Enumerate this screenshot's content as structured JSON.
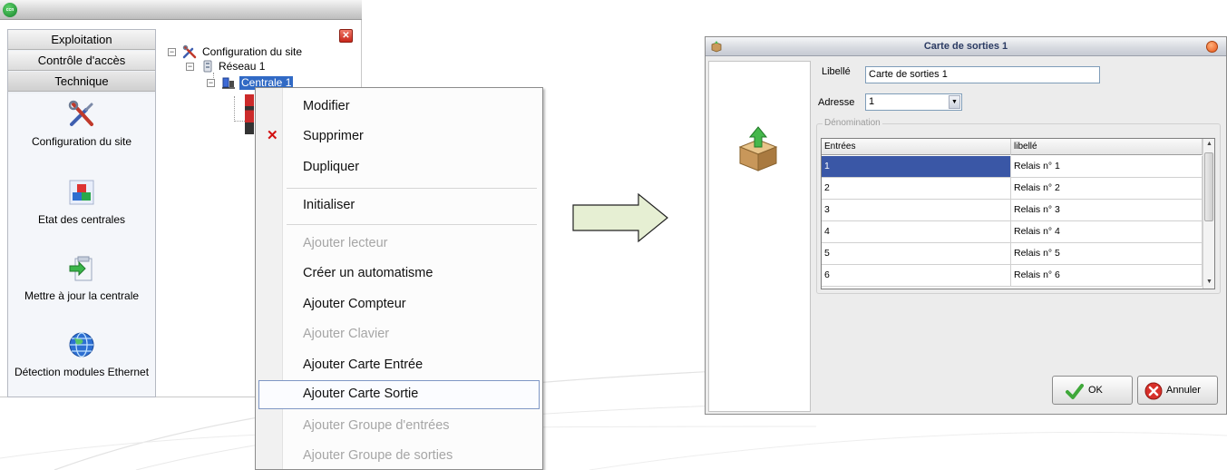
{
  "nav": {
    "tabs": [
      "Exploitation",
      "Contrôle d'accès",
      "Technique"
    ],
    "items": [
      {
        "label": "Configuration du site",
        "icon": "tools-icon"
      },
      {
        "label": "Etat des centrales",
        "icon": "status-blocks-icon"
      },
      {
        "label": "Mettre à jour la centrale",
        "icon": "update-arrow-icon"
      },
      {
        "label": "Détection modules Ethernet",
        "icon": "globe-network-icon"
      }
    ]
  },
  "tree": {
    "root": "Configuration du site",
    "network": "Réseau 1",
    "central": "Centrale 1"
  },
  "context_menu": {
    "items": [
      {
        "label": "Modifier",
        "enabled": true
      },
      {
        "label": "Supprimer",
        "enabled": true,
        "icon": "delete-x-icon"
      },
      {
        "label": "Dupliquer",
        "enabled": true
      },
      {
        "label": "Initialiser",
        "enabled": true
      },
      {
        "label": "Ajouter lecteur",
        "enabled": false
      },
      {
        "label": "Créer un automatisme",
        "enabled": true
      },
      {
        "label": "Ajouter Compteur",
        "enabled": true
      },
      {
        "label": "Ajouter Clavier",
        "enabled": false
      },
      {
        "label": "Ajouter Carte Entrée",
        "enabled": true
      },
      {
        "label": "Ajouter Carte Sortie",
        "enabled": true,
        "highlighted": true
      },
      {
        "label": "Ajouter Groupe d'entrées",
        "enabled": false
      },
      {
        "label": "Ajouter Groupe de sorties",
        "enabled": false
      }
    ]
  },
  "dialog": {
    "title": "Carte de sorties 1",
    "libelle_label": "Libellé",
    "libelle_value": "Carte de sorties 1",
    "adresse_label": "Adresse",
    "adresse_value": "1",
    "group_label": "Dénomination",
    "table": {
      "columns": [
        "Entrées",
        "libellé"
      ],
      "rows": [
        [
          "1",
          "Relais n° 1"
        ],
        [
          "2",
          "Relais n° 2"
        ],
        [
          "3",
          "Relais n° 3"
        ],
        [
          "4",
          "Relais n° 4"
        ],
        [
          "5",
          "Relais n° 5"
        ],
        [
          "6",
          "Relais n° 6"
        ]
      ],
      "selected_row": 0
    },
    "ok_label": "OK",
    "cancel_label": "Annuler"
  },
  "colors": {
    "selection": "#3a57a6",
    "tree_selection": "#316ac5",
    "arrow_fill": "#e6efd3",
    "delete_icon": "#d21010"
  }
}
